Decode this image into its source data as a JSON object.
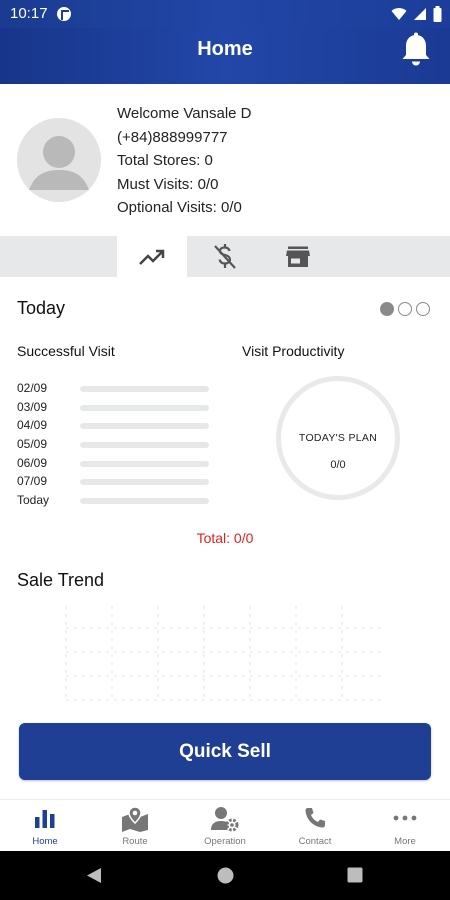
{
  "status": {
    "time": "10:17"
  },
  "header": {
    "title": "Home"
  },
  "profile": {
    "welcome": "Welcome Vansale D",
    "phone": "(+84)888999777",
    "stores": "Total Stores: 0",
    "must_visits": "Must Visits: 0/0",
    "optional_visits": "Optional Visits: 0/0"
  },
  "today": {
    "title": "Today",
    "successful_visit_label": "Successful Visit",
    "visit_productivity_label": "Visit Productivity",
    "visit_dates": [
      "02/09",
      "03/09",
      "04/09",
      "05/09",
      "06/09",
      "07/09",
      "Today"
    ],
    "plan_label": "TODAY'S PLAN",
    "plan_value": "0/0",
    "total": "Total: 0/0"
  },
  "sale_trend": {
    "title": "Sale Trend"
  },
  "quick_sell": {
    "label": "Quick Sell"
  },
  "nav": {
    "items": [
      {
        "label": "Home",
        "icon": "chart-bar-icon"
      },
      {
        "label": "Route",
        "icon": "map-pin-icon"
      },
      {
        "label": "Operation",
        "icon": "user-gear-icon"
      },
      {
        "label": "Contact",
        "icon": "phone-icon"
      },
      {
        "label": "More",
        "icon": "more-dots-icon"
      }
    ]
  },
  "colors": {
    "primary": "#1e3f94",
    "header": "#1c3d99",
    "total_red": "#e02020"
  }
}
